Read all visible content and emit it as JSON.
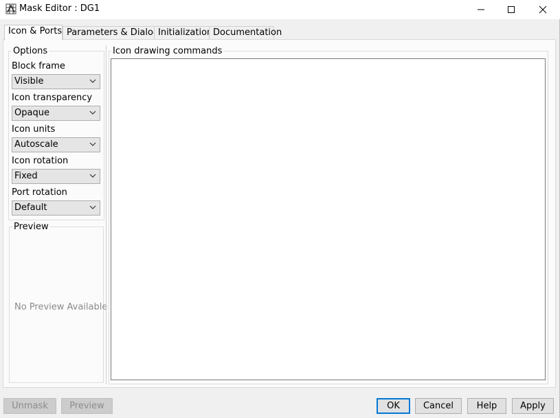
{
  "window": {
    "title": "Mask Editor : DG1",
    "icon": "matlab-grid-icon",
    "minimize_icon": "minimize-icon",
    "maximize_icon": "maximize-icon",
    "close_icon": "close-icon"
  },
  "tabs": [
    {
      "label": "Icon & Ports",
      "active": true
    },
    {
      "label": "Parameters & Dialog",
      "active": false
    },
    {
      "label": "Initialization",
      "active": false
    },
    {
      "label": "Documentation",
      "active": false
    }
  ],
  "options": {
    "group_title": "Options",
    "fields": [
      {
        "label": "Block frame",
        "value": "Visible"
      },
      {
        "label": "Icon transparency",
        "value": "Opaque"
      },
      {
        "label": "Icon units",
        "value": "Autoscale"
      },
      {
        "label": "Icon rotation",
        "value": "Fixed"
      },
      {
        "label": "Port rotation",
        "value": "Default"
      }
    ]
  },
  "preview": {
    "group_title": "Preview",
    "empty_text": "No Preview Available"
  },
  "commands": {
    "group_title": "Icon drawing commands",
    "value": ""
  },
  "buttons": {
    "unmask": "Unmask",
    "preview": "Preview",
    "ok": "OK",
    "cancel": "Cancel",
    "help": "Help",
    "apply": "Apply"
  },
  "colors": {
    "focus_border": "#0078d7",
    "disabled_text": "#8c8c8c"
  }
}
